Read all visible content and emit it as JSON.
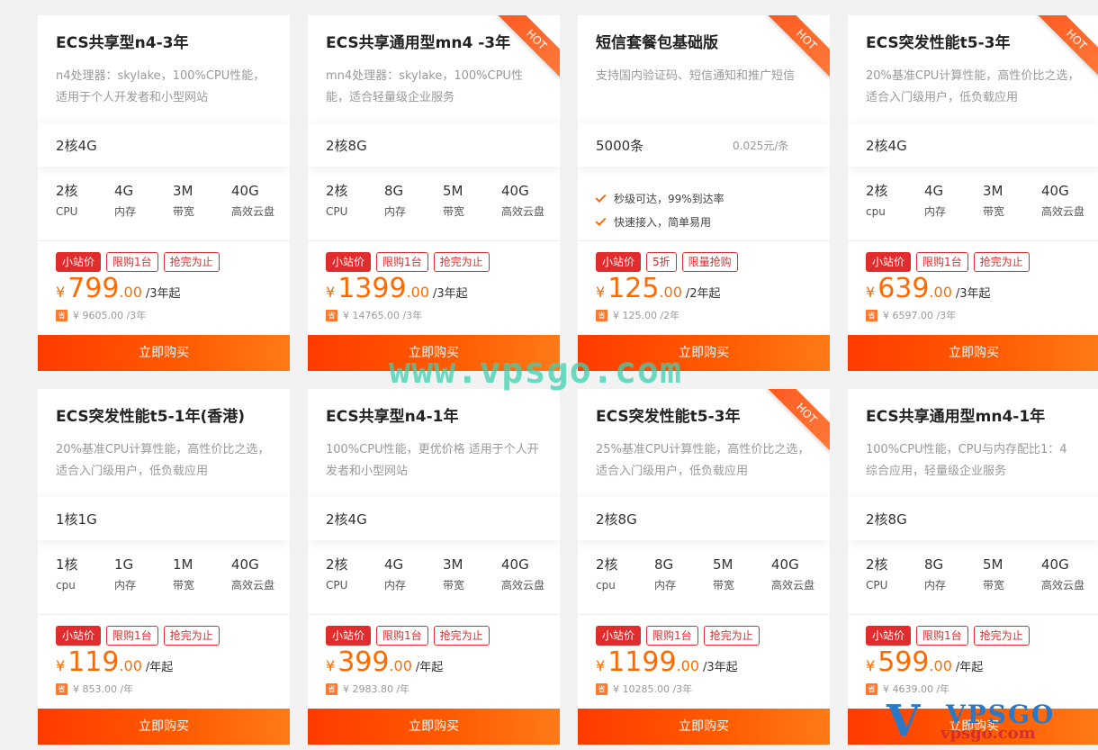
{
  "buy_label": "立即购买",
  "orig_icon_text": "省",
  "hot_label": "HOT",
  "currency": "¥",
  "watermark": "www.vpsgo.com",
  "logo": {
    "letter": "V",
    "brand": "VPSGO",
    "domain": "vpsgo.com"
  },
  "colors": {
    "accent": "#ff6a00",
    "tag": "#e02c2c",
    "button": "#ff4a00"
  },
  "cards": [
    {
      "title": "ECS共享型n4-3年",
      "desc": "n4处理器：skylake，100%CPU性能，适用于个人开发者和小型网站",
      "spec": "2核4G",
      "hot": false,
      "specs": [
        {
          "v": "2核",
          "l": "CPU"
        },
        {
          "v": "4G",
          "l": "内存"
        },
        {
          "v": "3M",
          "l": "带宽"
        },
        {
          "v": "40G",
          "l": "高效云盘"
        }
      ],
      "tags": [
        "小站价",
        "限购1台",
        "抢完为止"
      ],
      "price_int": "799",
      "price_dec": ".00",
      "price_suffix": "/3年起",
      "orig": "¥ 9605.00 /3年"
    },
    {
      "title": "ECS共享通用型mn4 -3年",
      "desc": "mn4处理器：skylake，100%CPU性能，适合轻量级企业服务",
      "spec": "2核8G",
      "hot": true,
      "specs": [
        {
          "v": "2核",
          "l": "CPU"
        },
        {
          "v": "8G",
          "l": "内存"
        },
        {
          "v": "5M",
          "l": "带宽"
        },
        {
          "v": "40G",
          "l": "高效云盘"
        }
      ],
      "tags": [
        "小站价",
        "限购1台",
        "抢完为止"
      ],
      "price_int": "1399",
      "price_dec": ".00",
      "price_suffix": "/3年起",
      "orig": "¥ 14765.00 /3年"
    },
    {
      "title": "短信套餐包基础版",
      "desc": "支持国内验证码、短信通知和推广短信",
      "spec": "5000条",
      "unit_price": "0.025元/条",
      "hot": true,
      "features": [
        "秒级可达，99%到达率",
        "快速接入，简单易用"
      ],
      "tags": [
        "小站价",
        "5折",
        "限量抢购"
      ],
      "price_int": "125",
      "price_dec": ".00",
      "price_suffix": "/2年起",
      "orig": "¥ 125.00 /2年"
    },
    {
      "title": "ECS突发性能t5-3年",
      "desc": "20%基准CPU计算性能，高性价比之选，适合入门级用户，低负载应用",
      "spec": "2核4G",
      "hot": true,
      "specs": [
        {
          "v": "2核",
          "l": "cpu"
        },
        {
          "v": "4G",
          "l": "内存"
        },
        {
          "v": "3M",
          "l": "带宽"
        },
        {
          "v": "40G",
          "l": "高效云盘"
        }
      ],
      "tags": [
        "小站价",
        "限购1台",
        "抢完为止"
      ],
      "price_int": "639",
      "price_dec": ".00",
      "price_suffix": "/3年起",
      "orig": "¥ 6597.00 /3年"
    },
    {
      "title": "ECS突发性能t5-1年(香港)",
      "desc": "20%基准CPU计算性能，高性价比之选，适合入门级用户，低负载应用",
      "spec": "1核1G",
      "hot": false,
      "specs": [
        {
          "v": "1核",
          "l": "cpu"
        },
        {
          "v": "1G",
          "l": "内存"
        },
        {
          "v": "1M",
          "l": "带宽"
        },
        {
          "v": "40G",
          "l": "高效云盘"
        }
      ],
      "tags": [
        "小站价",
        "限购1台",
        "抢完为止"
      ],
      "price_int": "119",
      "price_dec": ".00",
      "price_suffix": "/年起",
      "orig": "¥ 853.00 /年"
    },
    {
      "title": "ECS共享型n4-1年",
      "desc": "100%CPU性能，更优价格 适用于个人开发者和小型网站",
      "spec": "2核4G",
      "hot": false,
      "specs": [
        {
          "v": "2核",
          "l": "CPU"
        },
        {
          "v": "4G",
          "l": "内存"
        },
        {
          "v": "3M",
          "l": "带宽"
        },
        {
          "v": "40G",
          "l": "高效云盘"
        }
      ],
      "tags": [
        "小站价",
        "限购1台",
        "抢完为止"
      ],
      "price_int": "399",
      "price_dec": ".00",
      "price_suffix": "/年起",
      "orig": "¥ 2983.80 /年"
    },
    {
      "title": "ECS突发性能t5-3年",
      "desc": "25%基准CPU计算性能，高性价比之选，适合入门级用户，低负载应用",
      "spec": "2核8G",
      "hot": true,
      "specs": [
        {
          "v": "2核",
          "l": "cpu"
        },
        {
          "v": "8G",
          "l": "内存"
        },
        {
          "v": "5M",
          "l": "带宽"
        },
        {
          "v": "40G",
          "l": "高效云盘"
        }
      ],
      "tags": [
        "小站价",
        "限购1台",
        "抢完为止"
      ],
      "price_int": "1199",
      "price_dec": ".00",
      "price_suffix": "/3年起",
      "orig": "¥ 10285.00 /3年"
    },
    {
      "title": "ECS共享通用型mn4-1年",
      "desc": "100%CPU性能，CPU与内存配比1：4 综合应用，轻量级企业服务",
      "spec": "2核8G",
      "hot": false,
      "specs": [
        {
          "v": "2核",
          "l": "CPU"
        },
        {
          "v": "8G",
          "l": "内存"
        },
        {
          "v": "5M",
          "l": "带宽"
        },
        {
          "v": "40G",
          "l": "高效云盘"
        }
      ],
      "tags": [
        "小站价",
        "限购1台",
        "抢完为止"
      ],
      "price_int": "599",
      "price_dec": ".00",
      "price_suffix": "/年起",
      "orig": "¥ 4639.00 /年"
    }
  ]
}
